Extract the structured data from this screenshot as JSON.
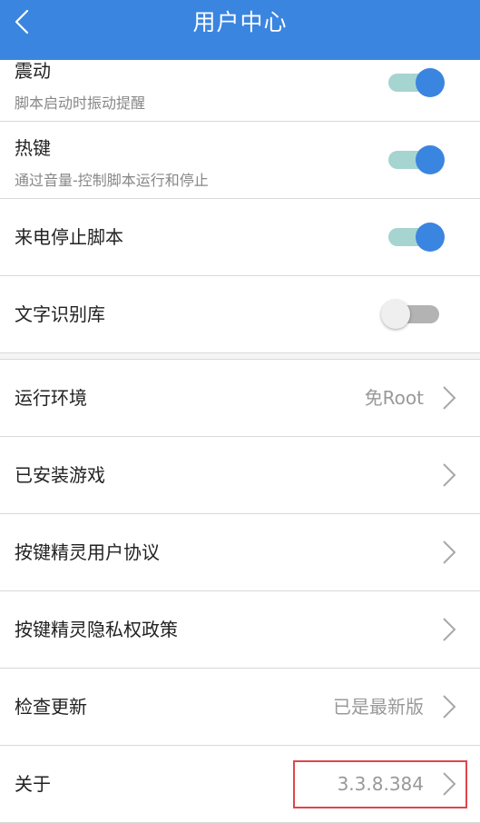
{
  "header": {
    "title": "用户中心"
  },
  "settings": {
    "vibration": {
      "title": "震动",
      "subtitle": "脚本启动时振动提醒",
      "enabled": true
    },
    "hotkey": {
      "title": "热键",
      "subtitle": "通过音量-控制脚本运行和停止",
      "enabled": true
    },
    "call_stop": {
      "title": "来电停止脚本",
      "enabled": true
    },
    "ocr_library": {
      "title": "文字识别库",
      "enabled": false
    }
  },
  "menu": {
    "runtime": {
      "label": "运行环境",
      "value": "免Root"
    },
    "installed_games": {
      "label": "已安装游戏"
    },
    "user_agreement": {
      "label": "按键精灵用户协议"
    },
    "privacy_policy": {
      "label": "按键精灵隐私权政策"
    },
    "check_update": {
      "label": "检查更新",
      "value": "已是最新版"
    },
    "about": {
      "label": "关于",
      "value": "3.3.8.384"
    }
  },
  "colors": {
    "header_bg": "#3a85e0",
    "toggle_on_track": "#a6d4d0",
    "toggle_on_knob": "#3a85e0",
    "highlight": "#e0464a"
  },
  "icons": {
    "back": "chevron-left-icon",
    "row_arrow": "chevron-right-icon"
  }
}
